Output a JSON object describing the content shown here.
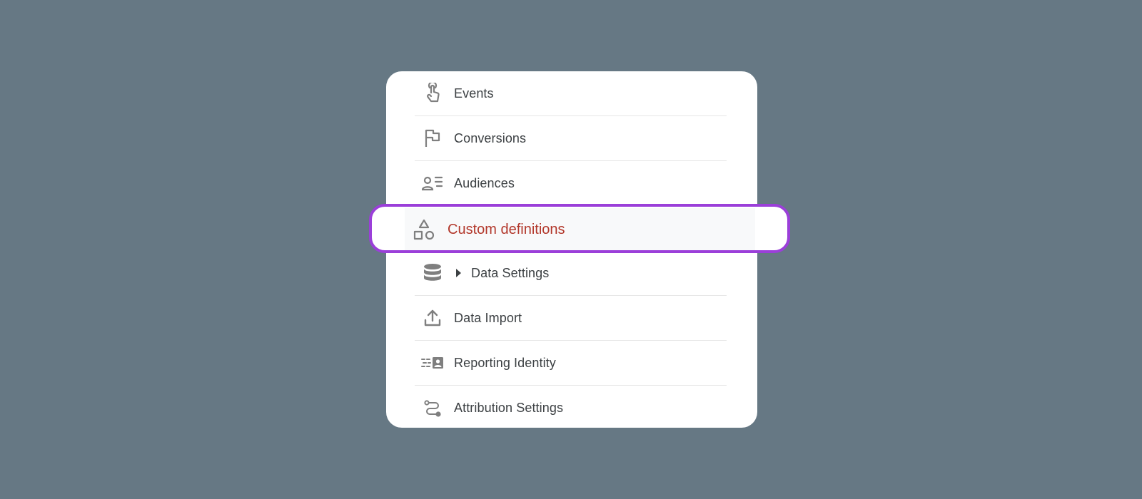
{
  "menu": {
    "items": [
      {
        "label": "Events",
        "icon": "touch-icon"
      },
      {
        "label": "Conversions",
        "icon": "flag-icon"
      },
      {
        "label": "Audiences",
        "icon": "audience-icon"
      },
      {
        "label": "Custom definitions",
        "icon": "shapes-icon",
        "selected": true
      },
      {
        "label": "Data Settings",
        "icon": "database-icon",
        "expandable": true
      },
      {
        "label": "Data Import",
        "icon": "upload-icon"
      },
      {
        "label": "Reporting Identity",
        "icon": "identity-icon"
      },
      {
        "label": "Attribution Settings",
        "icon": "route-icon"
      }
    ]
  },
  "colors": {
    "background": "#667884",
    "highlight_border": "#9b3fd9",
    "selected_text": "#b2372a",
    "icon": "#7f7f7f",
    "text": "#3c4043"
  }
}
